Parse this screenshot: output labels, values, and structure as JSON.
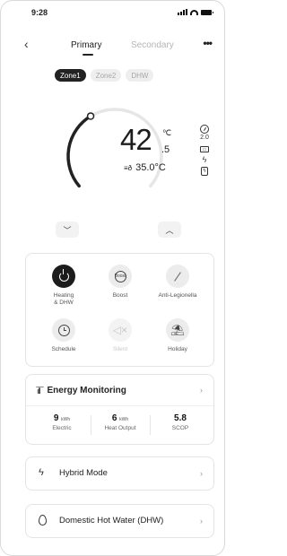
{
  "status_bar": {
    "time": "9:28"
  },
  "nav": {
    "back_glyph": "‹",
    "tabs": [
      "Primary",
      "Secondary"
    ],
    "more_glyph": "•••"
  },
  "zones": [
    "Zone1",
    "Zone2",
    "DHW"
  ],
  "thermostat": {
    "set_temp_int": "42",
    "set_temp_unit": "℃",
    "set_temp_dec": ".5",
    "indoor_temp": "35.0°C",
    "dial_fraction": 0.38,
    "side_value": "2.0"
  },
  "modes": [
    {
      "label": "Heating\n& DHW",
      "icon": "power-icon",
      "state": "active"
    },
    {
      "label": "Boost",
      "icon": "boost-icon",
      "state": "normal"
    },
    {
      "label": "Anti-Legionella",
      "icon": "slash-icon",
      "state": "normal"
    },
    {
      "label": "Schedule",
      "icon": "clock-icon",
      "state": "normal"
    },
    {
      "label": "Silent",
      "icon": "mute-icon",
      "state": "disabled"
    },
    {
      "label": "Holiday",
      "icon": "beach-icon",
      "state": "normal"
    }
  ],
  "boost_icon_text": "Boost",
  "energy": {
    "title": "Energy Monitoring",
    "stats": [
      {
        "value": "9",
        "unit": "kWh",
        "label": "Electric"
      },
      {
        "value": "6",
        "unit": "kWh",
        "label": "Heat Output"
      },
      {
        "value": "5.8",
        "unit": "",
        "label": "SCOP"
      }
    ]
  },
  "hybrid": {
    "title": "Hybrid Mode"
  },
  "dhw": {
    "title": "Domestic Hot Water (DHW)"
  },
  "colors": {
    "dark": "#1c1c1c",
    "light_grey": "#ececec",
    "text": "#1d1d1f"
  }
}
